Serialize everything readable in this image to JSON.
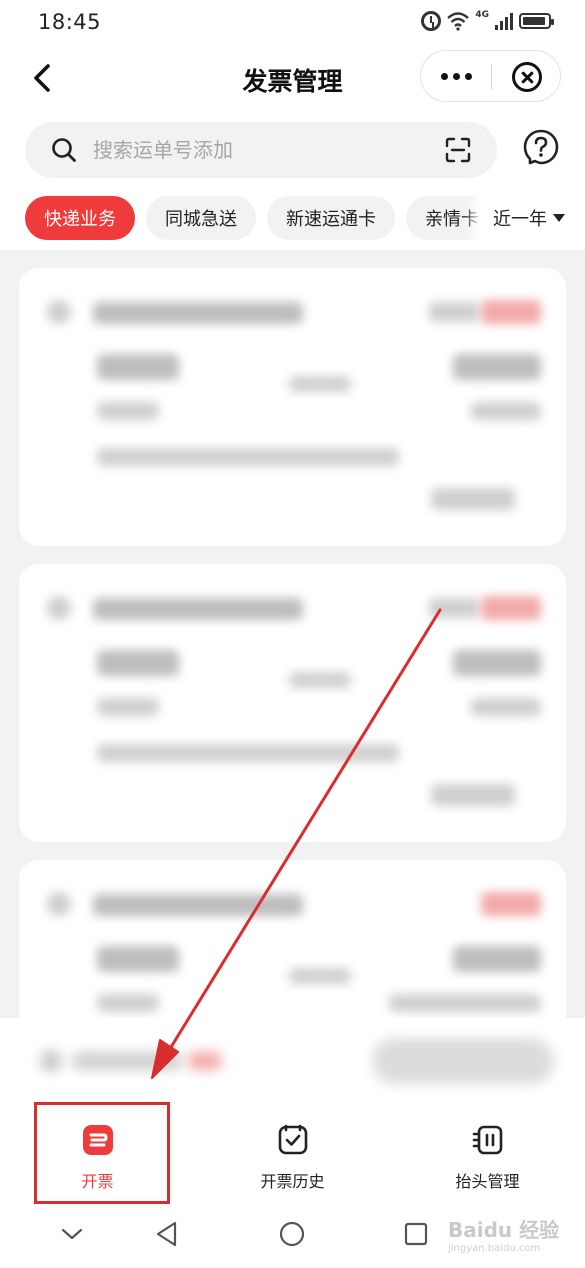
{
  "status_bar": {
    "time": "18:45",
    "network": "4G"
  },
  "nav": {
    "title": "发票管理"
  },
  "search": {
    "placeholder": "搜索运单号添加"
  },
  "filters": {
    "chips": [
      {
        "label": "快递业务",
        "active": true
      },
      {
        "label": "同城急送",
        "active": false
      },
      {
        "label": "新速运通卡",
        "active": false
      },
      {
        "label": "亲情卡",
        "active": false
      }
    ],
    "range_label": "近一年"
  },
  "tabs": [
    {
      "label": "开票",
      "icon": "invoice-icon",
      "active": true
    },
    {
      "label": "开票历史",
      "icon": "invoice-history-icon",
      "active": false
    },
    {
      "label": "抬头管理",
      "icon": "title-manage-icon",
      "active": false
    }
  ],
  "watermark": {
    "brand": "Baidu 经验",
    "url": "jingyan.baidu.com"
  },
  "colors": {
    "accent": "#ef3b3b",
    "annotation": "#d92d2d",
    "page_bg": "#f2f2f2"
  }
}
